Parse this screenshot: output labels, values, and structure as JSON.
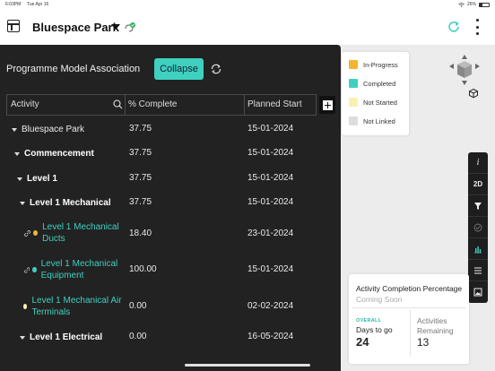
{
  "status_bar": {
    "time": "6:03PM",
    "date": "Tue Apr 16",
    "battery": "26%"
  },
  "header": {
    "project_title": "Bluespace Park"
  },
  "panel": {
    "title": "Programme Model Association",
    "collapse_label": "Collapse",
    "columns": {
      "activity": "Activity",
      "complete": "% Complete",
      "start": "Planned Start"
    }
  },
  "rows": [
    {
      "name": "Bluespace Park",
      "pct": "37.75",
      "start": "15-01-2024"
    },
    {
      "name": "Commencement",
      "pct": "37.75",
      "start": "15-01-2024"
    },
    {
      "name": "Level 1",
      "pct": "37.75",
      "start": "15-01-2024"
    },
    {
      "name": "Level 1 Mechanical",
      "pct": "37.75",
      "start": "15-01-2024"
    },
    {
      "name": "Level 1 Mechanical Ducts",
      "pct": "18.40",
      "start": "23-01-2024",
      "status": "In-Progress"
    },
    {
      "name": "Level 1 Mechanical Equipment",
      "pct": "100.00",
      "start": "15-01-2024",
      "status": "Completed"
    },
    {
      "name": "Level 1 Mechanical Air Terminals",
      "pct": "0.00",
      "start": "02-02-2024",
      "status": "Not Started"
    },
    {
      "name": "Level 1 Electrical",
      "pct": "0.00",
      "start": "16-05-2024"
    }
  ],
  "legend": [
    {
      "label": "In-Progress",
      "color": "#f2b632"
    },
    {
      "label": "Completed",
      "color": "#3fd0c0"
    },
    {
      "label": "Not Started",
      "color": "#fbf0b0"
    },
    {
      "label": "Not Linked",
      "color": "#dddddd"
    }
  ],
  "toolbar": {
    "two_d_label": "2D",
    "info_label": "i"
  },
  "completion_card": {
    "title": "Activity Completion Percentage",
    "subtitle": "Coming Soon",
    "overall_label": "OVERALL",
    "days_label": "Days to go",
    "days_value": "24",
    "remaining_label": "Activities Remaining",
    "remaining_value": "13"
  },
  "colors": {
    "accent": "#3fd0c0",
    "panel_bg": "#222222",
    "in_progress": "#f2b632"
  }
}
